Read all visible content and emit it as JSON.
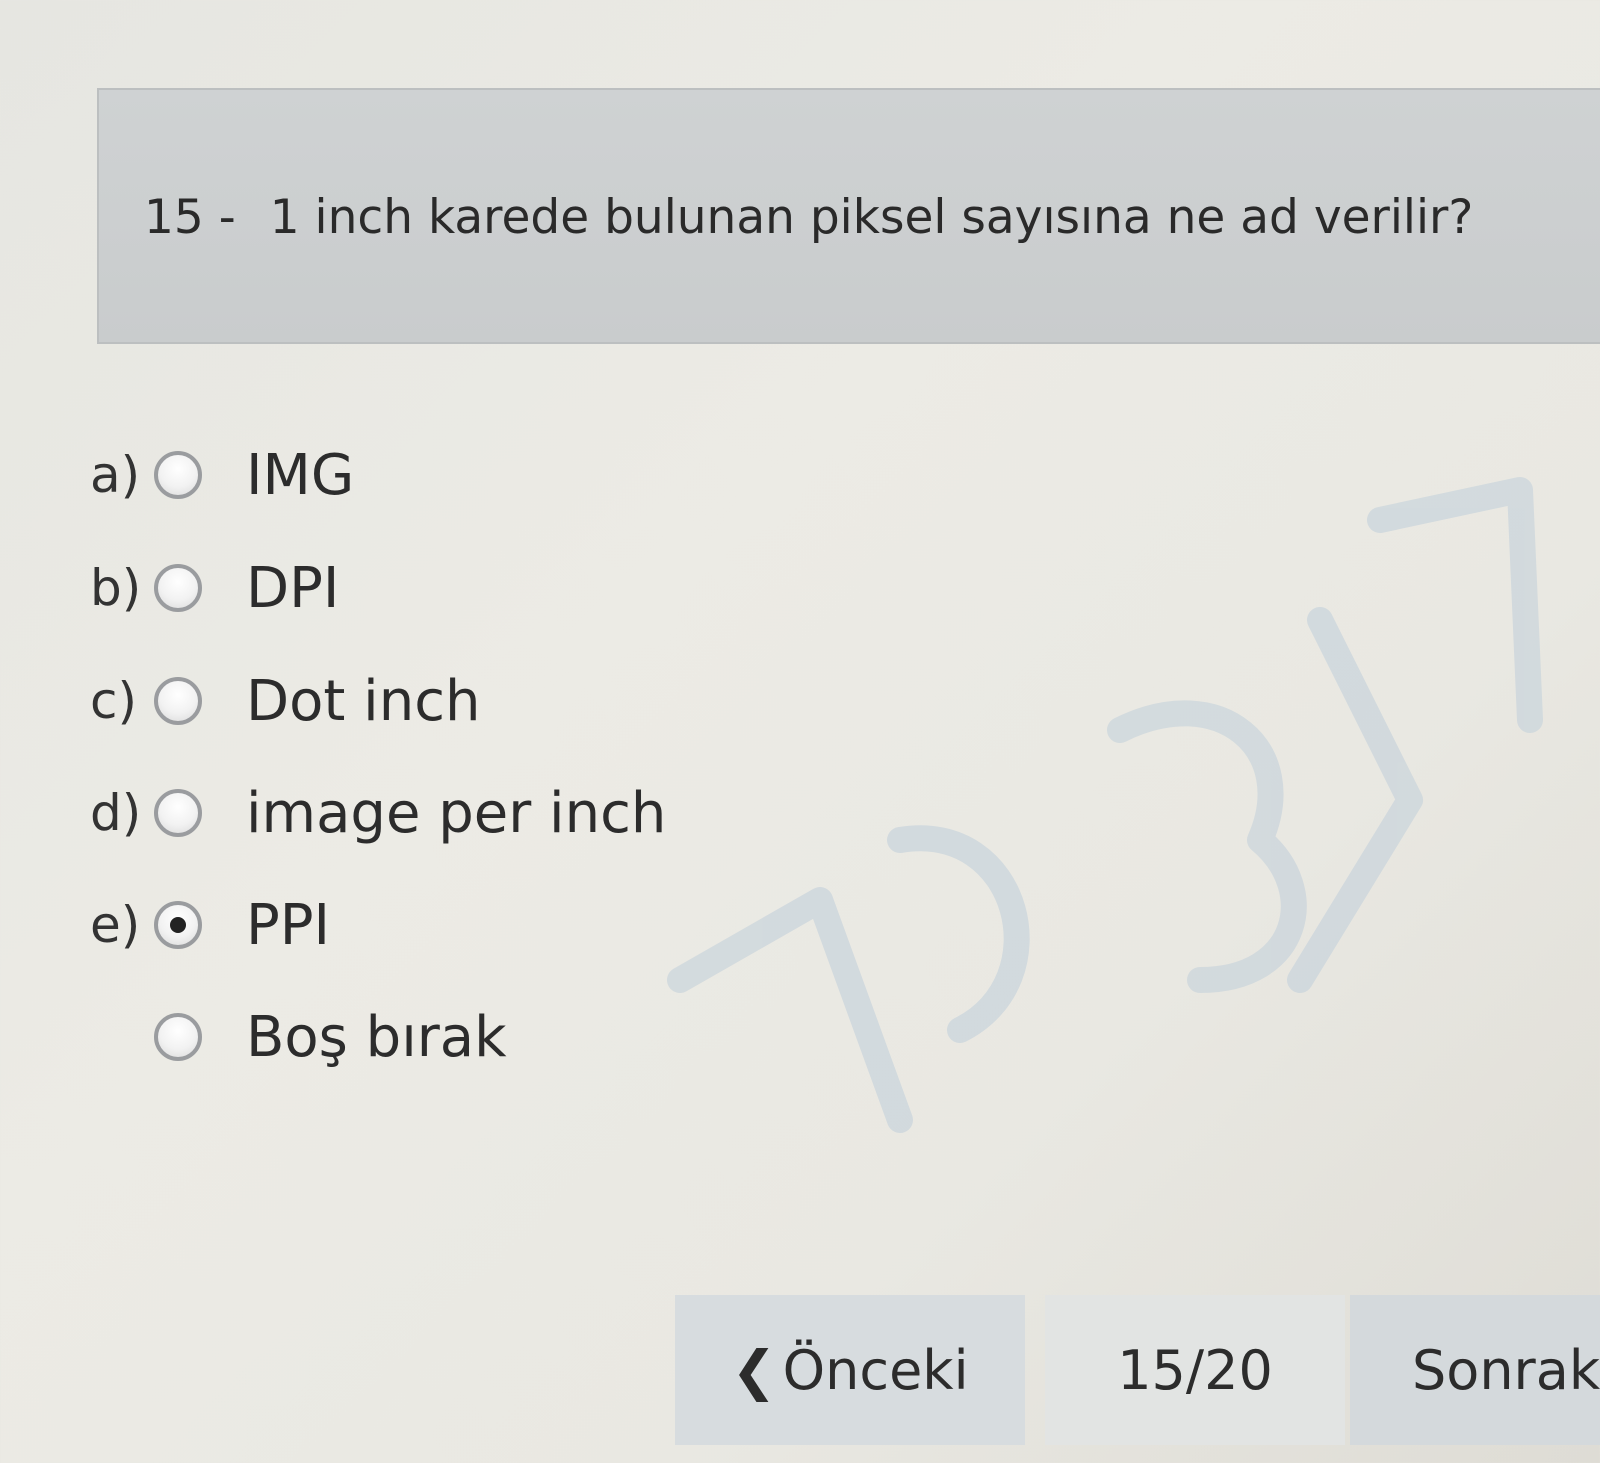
{
  "question": {
    "number": "15 -",
    "text": "1 inch karede bulunan piksel sayısına ne ad verilir?"
  },
  "options": [
    {
      "letter": "a)",
      "label": "IMG",
      "selected": false
    },
    {
      "letter": "b)",
      "label": "DPI",
      "selected": false
    },
    {
      "letter": "c)",
      "label": "Dot inch",
      "selected": false
    },
    {
      "letter": "d)",
      "label": "image per inch",
      "selected": false
    },
    {
      "letter": "e)",
      "label": "PPI",
      "selected": true
    },
    {
      "letter": "",
      "label": "Boş bırak",
      "selected": false
    }
  ],
  "navigation": {
    "prev_icon": "chevron-left-icon",
    "prev_label": "Önceki",
    "page": "15/20",
    "next_label": "Sonraki"
  },
  "colors": {
    "question_bg": "#cbcecf",
    "page_bg": "#e8e7e1",
    "nav_bg": "#d7dcdf",
    "watermark": "#c7d3dc"
  }
}
